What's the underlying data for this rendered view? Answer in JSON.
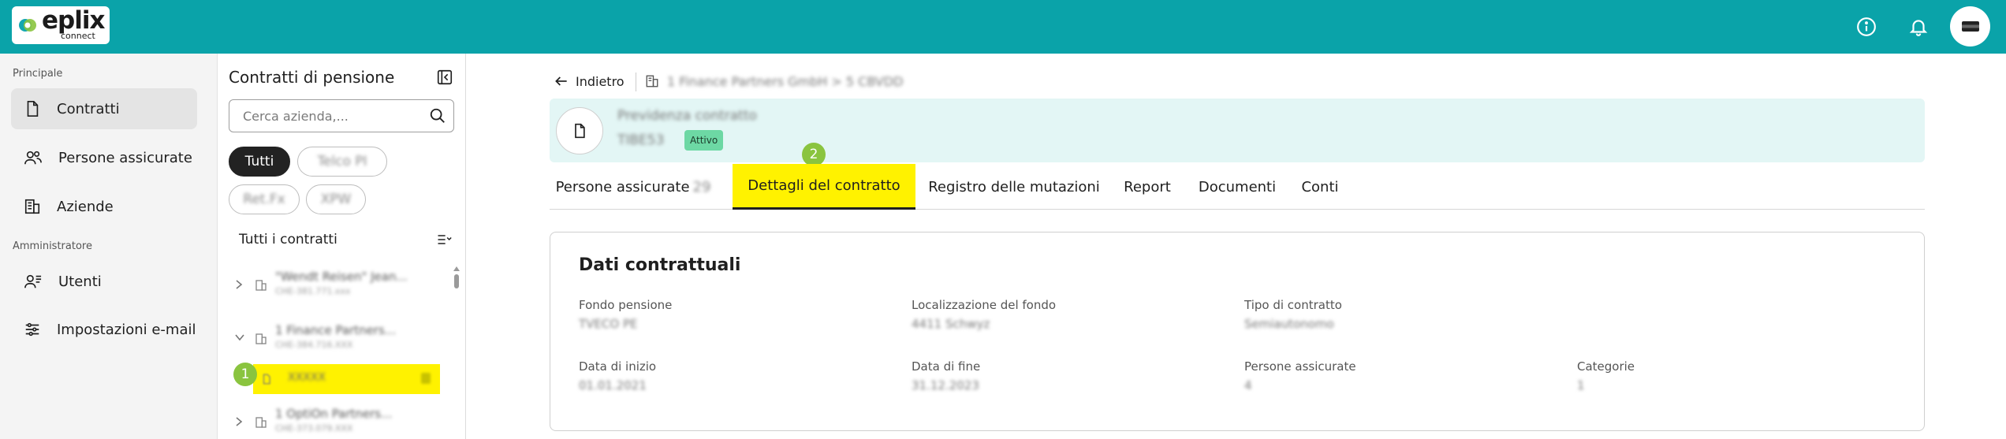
{
  "header": {
    "logo_brand": "eplix",
    "logo_sub": "connect",
    "colors": {
      "topbar": "#0aa3a9",
      "highlight": "#fff200",
      "step_badge": "#8ac43f",
      "status_active": "#6dd8a4"
    }
  },
  "leftnav": {
    "section_main": "Principale",
    "items_main": [
      {
        "label": "Contratti",
        "icon": "document-icon",
        "active": true
      },
      {
        "label": "Persone assicurate",
        "icon": "people-icon",
        "active": false
      },
      {
        "label": "Aziende",
        "icon": "building-icon",
        "active": false
      }
    ],
    "section_admin": "Amministratore",
    "items_admin": [
      {
        "label": "Utenti",
        "icon": "users-admin-icon"
      },
      {
        "label": "Impostazioni e-mail",
        "icon": "sliders-icon"
      }
    ]
  },
  "panel": {
    "title": "Contratti di pensione",
    "search_placeholder": "Cerca azienda,...",
    "chips": [
      "Tutti",
      "Telco PI",
      "Ret.Fx",
      "XPW"
    ],
    "list_header": "Tutti i contratti",
    "rows": [
      {
        "line1": "\"Wendt Reisen\" Jean...",
        "line2": "CHE-381.771.xxx",
        "expanded": false
      },
      {
        "line1": "1 Finance Partners...",
        "line2": "CHE-384.716.XXX",
        "expanded": true
      },
      {
        "line1": "XXXXX",
        "line2": "",
        "child": true,
        "highlighted": true
      },
      {
        "line1": "1 OptiOn Partners...",
        "line2": "CHE-373.079.XXX",
        "expanded": false
      }
    ],
    "step_badge": "1"
  },
  "main": {
    "back_label": "Indietro",
    "breadcrumb_company": "1 Finance Partners GmbH > 5 CBVDD",
    "contract_name": "Previdenza contratto",
    "contract_id": "TIBE53",
    "status": "Attivo",
    "step_badge": "2",
    "tabs": [
      {
        "label": "Persone assicurate",
        "count": "29",
        "active": false
      },
      {
        "label": "Dettagli del contratto",
        "active": true
      },
      {
        "label": "Registro delle mutazioni",
        "active": false
      },
      {
        "label": "Report",
        "active": false
      },
      {
        "label": "Documenti",
        "active": false
      },
      {
        "label": "Conti",
        "active": false
      }
    ],
    "dati": {
      "title": "Dati contrattuali",
      "fields": [
        {
          "label": "Fondo pensione",
          "value": "TVECO PE"
        },
        {
          "label": "Localizzazione del fondo",
          "value": "4411 Schwyz"
        },
        {
          "label": "Tipo di contratto",
          "value": "Semiautonomo"
        },
        {
          "label": "Data di inizio",
          "value": "01.01.2021"
        },
        {
          "label": "Data di fine",
          "value": "31.12.2023"
        },
        {
          "label": "Persone assicurate",
          "value": "4"
        },
        {
          "label": "Categorie",
          "value": "1"
        }
      ]
    }
  }
}
